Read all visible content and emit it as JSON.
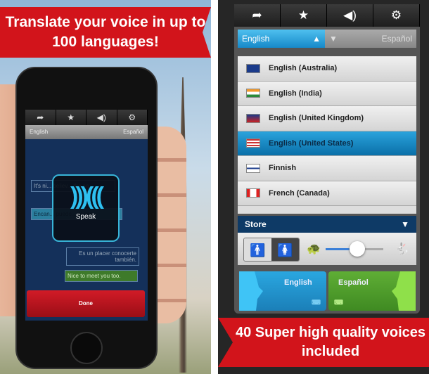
{
  "left": {
    "banner_text": "Translate your voice in up to 100 languages!",
    "toolbar_icons": [
      "share-icon",
      "star-icon",
      "speaker-icon",
      "gear-icon"
    ],
    "toolbar_glyphs": [
      "➦",
      "★",
      "◀)",
      "⚙"
    ],
    "source_lang": "English",
    "target_lang": "Español",
    "bubbles": [
      "It's ni... believ... the sa...",
      "Encan... puedo... el mis...",
      "Es un placer conocerte también.",
      "Nice to meet you too."
    ],
    "speak_label": "Speak",
    "done_label": "Done"
  },
  "right": {
    "toolbar_icons": [
      "share-icon",
      "star-icon",
      "speaker-icon",
      "gear-icon"
    ],
    "toolbar_glyphs": [
      "➦",
      "★",
      "◀)",
      "⚙"
    ],
    "source_lang": "English",
    "target_lang": "Español",
    "languages": [
      {
        "label": "English (Australia)",
        "selected": false
      },
      {
        "label": "English (India)",
        "selected": false
      },
      {
        "label": "English (United Kingdom)",
        "selected": false
      },
      {
        "label": "English (United States)",
        "selected": true
      },
      {
        "label": "Finnish",
        "selected": false
      },
      {
        "label": "French (Canada)",
        "selected": false
      }
    ],
    "store_label": "Store",
    "gender_selected": "female",
    "speed_value": 0.55,
    "voice_left": "English",
    "voice_right": "Español",
    "banner_text": "40 Super high quality voices included"
  },
  "colors": {
    "banner": "#d2141b",
    "accent_blue": "#1689c9",
    "voice_blue": "#2a9fd6",
    "voice_green": "#5aa032"
  }
}
